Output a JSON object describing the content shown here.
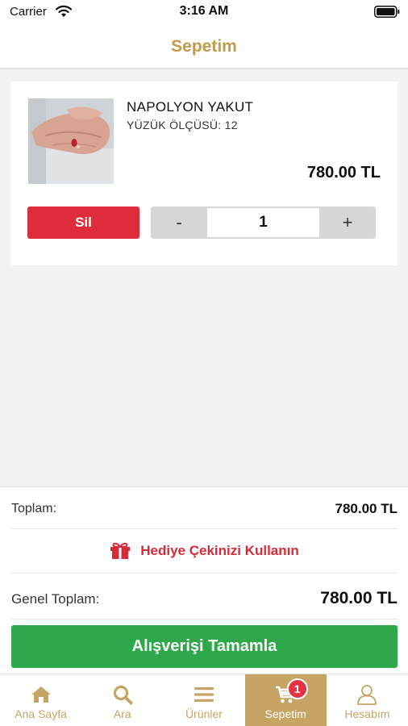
{
  "status_bar": {
    "carrier": "Carrier",
    "time": "3:16 AM"
  },
  "nav": {
    "title": "Sepetim"
  },
  "cart": {
    "items": [
      {
        "name": "NAPOLYON YAKUT",
        "size": "YÜZÜK ÖLÇÜSÜ: 12",
        "price": "780.00 TL",
        "delete_label": "Sil",
        "minus_label": "-",
        "plus_label": "+",
        "quantity": "1"
      }
    ]
  },
  "summary": {
    "total_label": "Toplam:",
    "total_value": "780.00 TL",
    "gift_label": "Hediye Çekinizi Kullanın",
    "grand_total_label": "Genel Toplam:",
    "grand_total_value": "780.00 TL",
    "checkout_label": "Alışverişi Tamamla"
  },
  "tabs": [
    {
      "label": "Ana Sayfa",
      "icon": "home-icon"
    },
    {
      "label": "Ara",
      "icon": "search-icon"
    },
    {
      "label": "Ürünler",
      "icon": "menu-icon"
    },
    {
      "label": "Sepetim",
      "icon": "cart-icon",
      "badge": "1",
      "active": true
    },
    {
      "label": "Hesabım",
      "icon": "user-icon"
    }
  ],
  "colors": {
    "accent": "#c6a564",
    "title": "#c19a4b",
    "delete": "#de2c3b",
    "checkout": "#2ea84a",
    "gift": "#d62b39",
    "badge": "#e53244"
  }
}
